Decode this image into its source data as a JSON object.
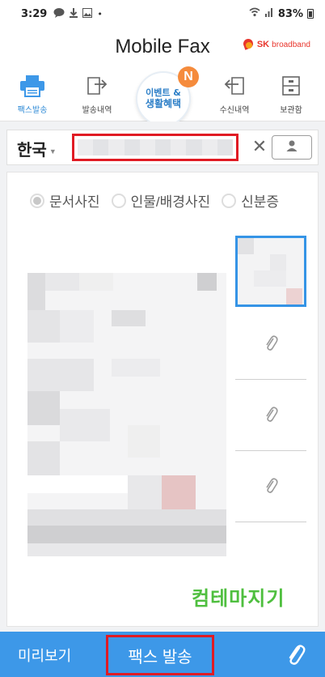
{
  "status_bar": {
    "time": "3:29",
    "battery": "83%",
    "icons": [
      "chat-icon",
      "download-icon",
      "image-icon",
      "dot-icon",
      "wifi-icon",
      "signal-icon",
      "battery-icon"
    ]
  },
  "header": {
    "title": "Mobile Fax",
    "brand_sk": "SK",
    "brand_name": "broadband"
  },
  "tabs": [
    {
      "label": "팩스발송",
      "icon": "printer-icon",
      "active": true
    },
    {
      "label": "발송내역",
      "icon": "send-history-icon",
      "active": false
    },
    {
      "label": "수신내역",
      "icon": "receive-history-icon",
      "active": false
    },
    {
      "label": "보관함",
      "icon": "archive-icon",
      "active": false
    }
  ],
  "event": {
    "line1": "이벤트 &",
    "line2": "생활혜택",
    "badge": "N"
  },
  "recipient": {
    "country": "한국",
    "clear": "✕"
  },
  "photo_types": [
    {
      "label": "문서사진",
      "checked": true
    },
    {
      "label": "인물/배경사진",
      "checked": false
    },
    {
      "label": "신분증",
      "checked": false
    }
  ],
  "watermark": "컴테마지기",
  "bottom": {
    "preview": "미리보기",
    "send": "팩스 발송"
  },
  "colors": {
    "accent": "#3d98e8",
    "highlight": "#e01b24",
    "badge": "#f58b3c",
    "watermark": "#4fbf3f"
  }
}
